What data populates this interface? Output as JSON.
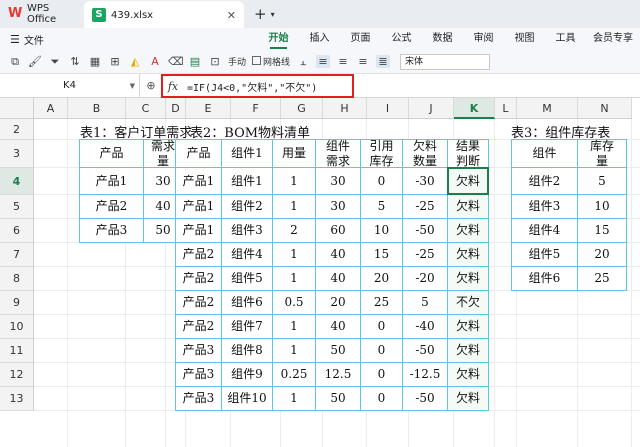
{
  "titlebar": {
    "app_tab": "WPS Office",
    "file_tab": "439.xlsx"
  },
  "menubar": {
    "file_label": "文件",
    "items": [
      "开始",
      "插入",
      "页面",
      "公式",
      "数据",
      "审阅",
      "视图",
      "工具",
      "会员专享"
    ]
  },
  "toolbar": {
    "manual_label": "手动",
    "gridline_label": "网格线",
    "font_name": "宋体"
  },
  "formula_bar": {
    "cell_ref": "K4",
    "fx_label": "fx",
    "formula": "=IF(J4<0,\"欠料\",\"不欠\")"
  },
  "grid": {
    "columns": [
      "A",
      "B",
      "C",
      "D",
      "E",
      "F",
      "G",
      "H",
      "I",
      "J",
      "K",
      "L",
      "M",
      "N"
    ],
    "rows": [
      "2",
      "3",
      "4",
      "5",
      "6",
      "7",
      "8",
      "9",
      "10",
      "11",
      "12",
      "13"
    ],
    "selected_column": "K",
    "selected_row": "4"
  },
  "table1": {
    "title": "表1：客户订单需求",
    "headers": [
      "产品",
      "需求\n量"
    ],
    "rows": [
      [
        "产品1",
        "30"
      ],
      [
        "产品2",
        "40"
      ],
      [
        "产品3",
        "50"
      ]
    ]
  },
  "table2": {
    "title": "表2：BOM物料清单",
    "headers": [
      "产品",
      "组件1",
      "用量",
      "组件\n需求",
      "引用\n库存",
      "欠料\n数量",
      "结果\n判断"
    ],
    "rows": [
      [
        "产品1",
        "组件1",
        "1",
        "30",
        "0",
        "-30",
        "欠料"
      ],
      [
        "产品1",
        "组件2",
        "1",
        "30",
        "5",
        "-25",
        "欠料"
      ],
      [
        "产品1",
        "组件3",
        "2",
        "60",
        "10",
        "-50",
        "欠料"
      ],
      [
        "产品2",
        "组件4",
        "1",
        "40",
        "15",
        "-25",
        "欠料"
      ],
      [
        "产品2",
        "组件5",
        "1",
        "40",
        "20",
        "-20",
        "欠料"
      ],
      [
        "产品2",
        "组件6",
        "0.5",
        "20",
        "25",
        "5",
        "不欠"
      ],
      [
        "产品2",
        "组件7",
        "1",
        "40",
        "0",
        "-40",
        "欠料"
      ],
      [
        "产品3",
        "组件8",
        "1",
        "50",
        "0",
        "-50",
        "欠料"
      ],
      [
        "产品3",
        "组件9",
        "0.25",
        "12.5",
        "0",
        "-12.5",
        "欠料"
      ],
      [
        "产品3",
        "组件10",
        "1",
        "50",
        "0",
        "-50",
        "欠料"
      ]
    ]
  },
  "table3": {
    "title": "表3：组件库存表",
    "headers": [
      "组件",
      "库存\n量"
    ],
    "rows": [
      [
        "组件2",
        "5"
      ],
      [
        "组件3",
        "10"
      ],
      [
        "组件4",
        "15"
      ],
      [
        "组件5",
        "20"
      ],
      [
        "组件6",
        "25"
      ]
    ]
  },
  "colors": {
    "accent": "#1a7f4b",
    "table_border": "#5fc4e6",
    "highlight_box": "#e02020"
  }
}
